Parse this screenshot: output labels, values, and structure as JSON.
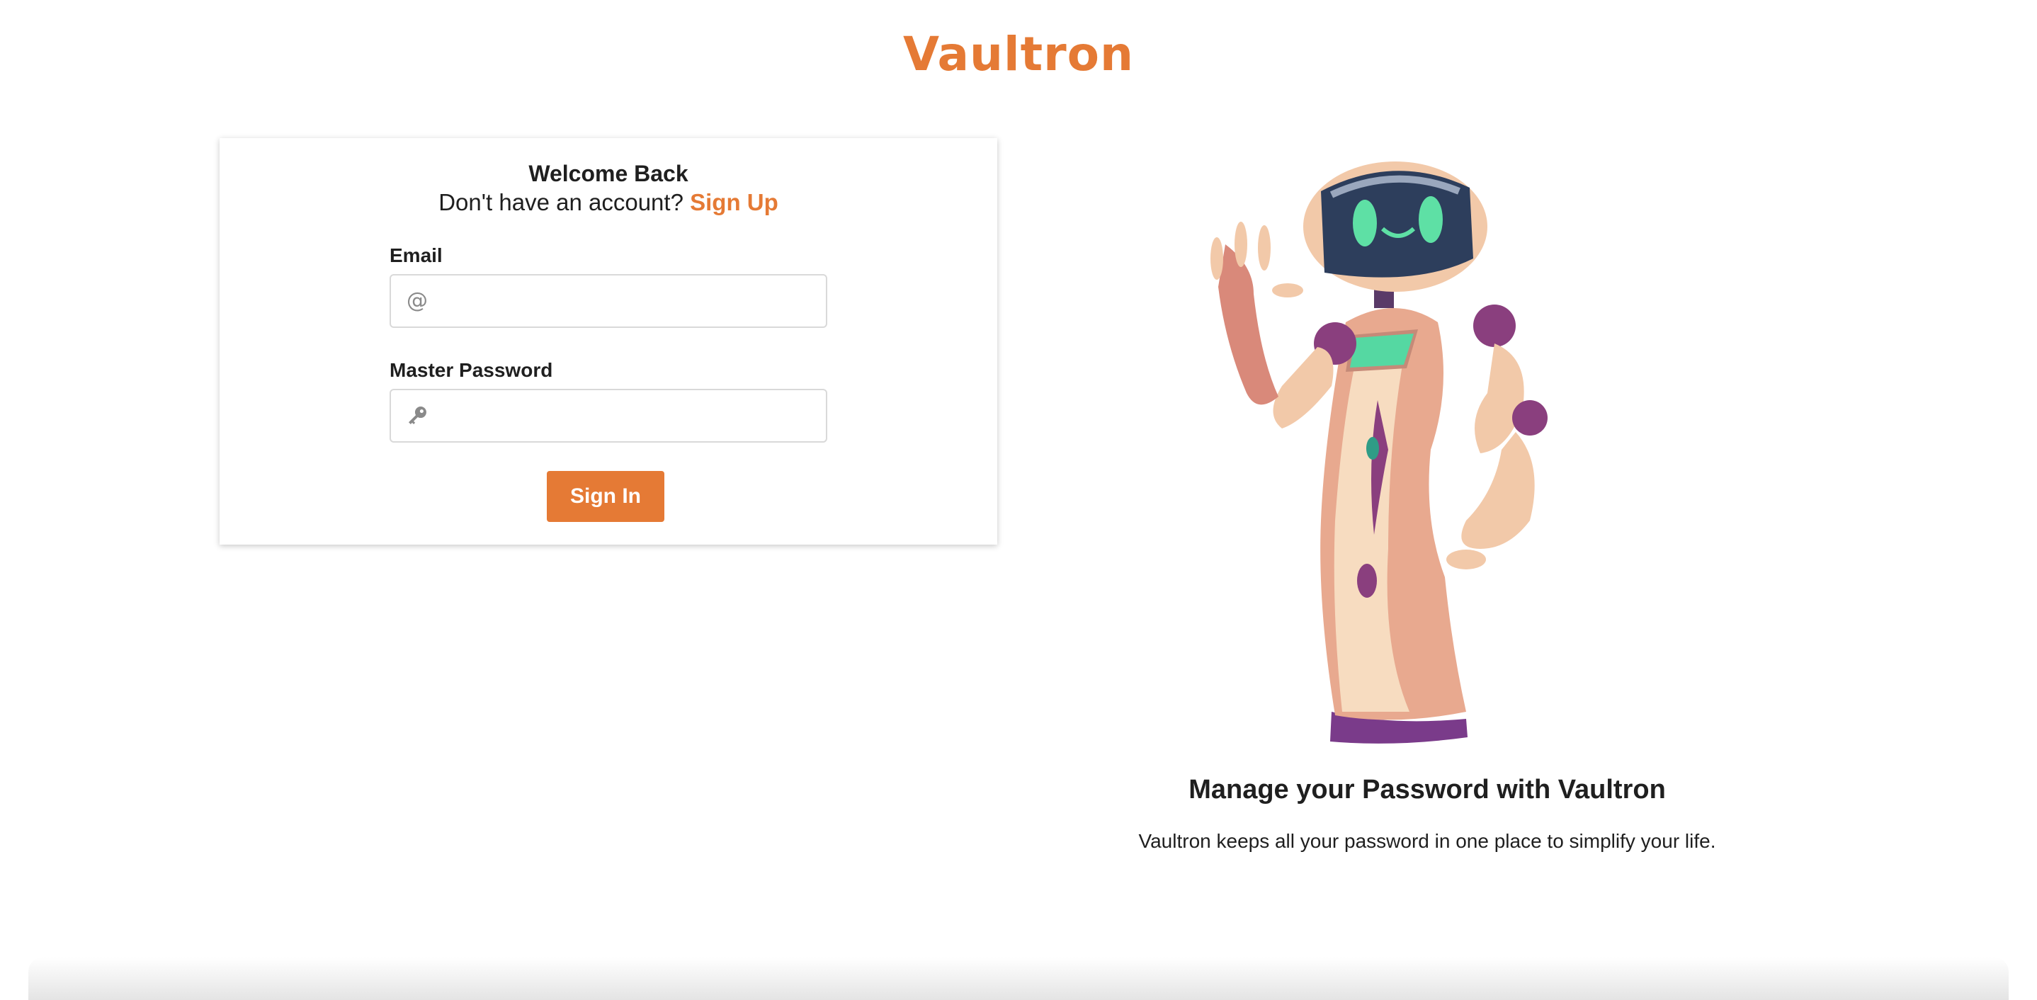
{
  "brand": {
    "logo_text": "Vaultron",
    "accent_color": "#e57a35"
  },
  "login_card": {
    "title": "Welcome Back",
    "signup_prompt": "Don't have an account?",
    "signup_link": "Sign Up",
    "email": {
      "label": "Email",
      "icon": "at-icon",
      "value": "",
      "placeholder": ""
    },
    "password": {
      "label": "Master Password",
      "icon": "key-icon",
      "value": "",
      "placeholder": ""
    },
    "submit_label": "Sign In"
  },
  "hero": {
    "illustration": "waving-robot",
    "title": "Manage your Password with Vaultron",
    "subtitle": "Vaultron keeps all your password in one place to simplify your life."
  }
}
